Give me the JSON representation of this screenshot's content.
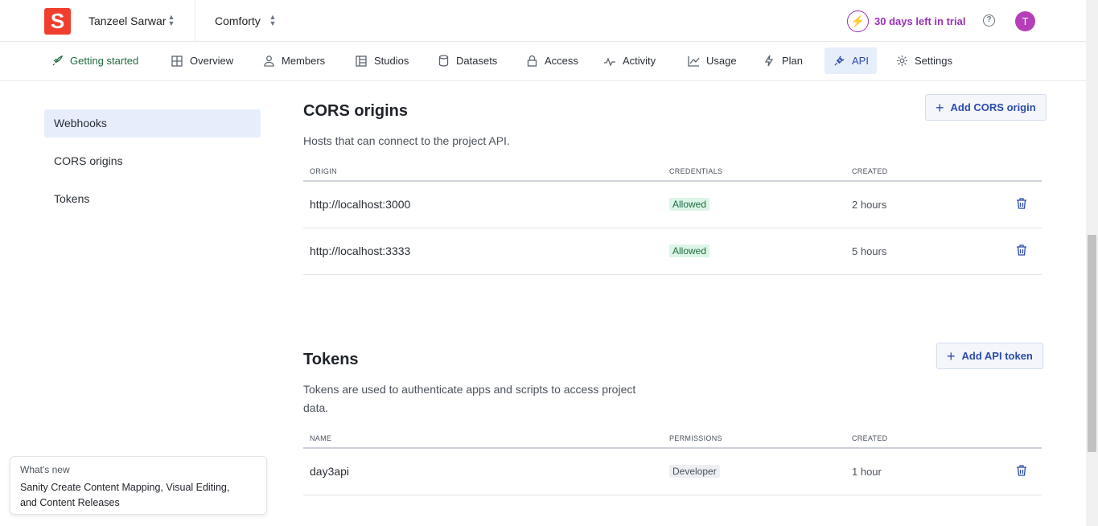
{
  "topbar": {
    "logo_letter": "S",
    "org_name": "Tanzeel Sarwar",
    "project_name": "Comforty",
    "trial_text": "30 days left in trial",
    "help_icon": "?",
    "avatar_initial": "T"
  },
  "nav": {
    "tabs": [
      {
        "label": "Getting started",
        "icon": "rocket-icon"
      },
      {
        "label": "Overview",
        "icon": "grid-icon"
      },
      {
        "label": "Members",
        "icon": "users-icon"
      },
      {
        "label": "Studios",
        "icon": "layout-icon"
      },
      {
        "label": "Datasets",
        "icon": "database-icon"
      },
      {
        "label": "Access",
        "icon": "lock-icon"
      },
      {
        "label": "Activity",
        "icon": "activity-icon"
      },
      {
        "label": "Usage",
        "icon": "chart-icon"
      },
      {
        "label": "Plan",
        "icon": "bolt-icon"
      },
      {
        "label": "API",
        "icon": "plug-icon"
      },
      {
        "label": "Settings",
        "icon": "gear-icon"
      }
    ],
    "active": "API"
  },
  "sidebar": {
    "items": [
      {
        "label": "Webhooks"
      },
      {
        "label": "CORS origins"
      },
      {
        "label": "Tokens"
      }
    ]
  },
  "cors": {
    "title": "CORS origins",
    "description": "Hosts that can connect to the project API.",
    "add_button": "Add CORS origin",
    "columns": [
      "ORIGIN",
      "CREDENTIALS",
      "CREATED"
    ],
    "rows": [
      {
        "origin": "http://localhost:3000",
        "credentials": "Allowed",
        "created": "2 hours"
      },
      {
        "origin": "http://localhost:3333",
        "credentials": "Allowed",
        "created": "5 hours"
      }
    ]
  },
  "tokens": {
    "title": "Tokens",
    "description_line1": "Tokens are used to authenticate apps and scripts to access project",
    "description_line2": "data.",
    "add_button": "Add API token",
    "columns": [
      "NAME",
      "PERMISSIONS",
      "CREATED"
    ],
    "rows": [
      {
        "name": "day3api",
        "permissions": "Developer",
        "created": "1 hour"
      }
    ]
  },
  "whats_new": {
    "label": "What's new",
    "text_line1": "Sanity Create Content Mapping, Visual Editing,",
    "text_line2": "and Content Releases"
  },
  "colors": {
    "brand_red": "#f03e2f",
    "accent_blue": "#2b4ca8",
    "trial_purple": "#9a2fb8",
    "success_green": "#1f6b3f"
  }
}
